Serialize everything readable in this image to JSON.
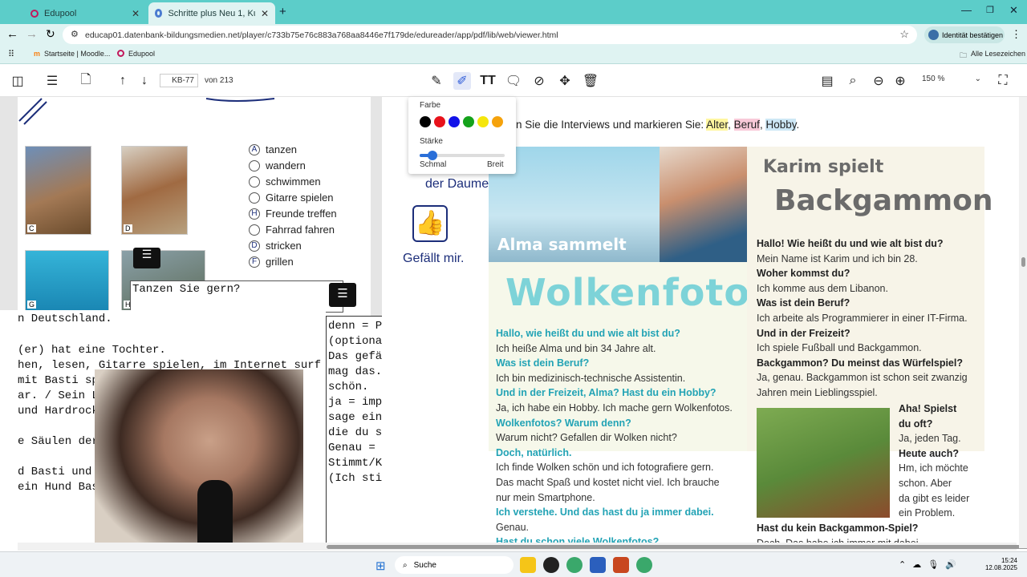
{
  "tabs": [
    {
      "label": "Edupool"
    },
    {
      "label": "Schritte plus Neu 1, Kurs- und A"
    }
  ],
  "address": {
    "url": "educap01.datenbank-bildungsmedien.net/player/c733b75e76c883a768aa8446e7f179de/edureader/app/pdf/lib/web/viewer.html",
    "identity": "Identität bestätigen"
  },
  "bookmarks": {
    "items": [
      "Startseite | Moodle...",
      "Edupool"
    ],
    "all": "Alle Lesezeichen"
  },
  "toolbar": {
    "page_input": "KB-77",
    "page_total": "von 213",
    "zoom": "150 %"
  },
  "color_popup": {
    "farbe": "Farbe",
    "staerke": "Stärke",
    "schmal": "Schmal",
    "breit": "Breit",
    "colors": [
      "#000000",
      "#e8121b",
      "#1212e8",
      "#14a21b",
      "#f5e60c",
      "#f5a20c"
    ],
    "strength": 0.15
  },
  "left_page": {
    "photo_labels": [
      "C",
      "D",
      "G",
      "H"
    ],
    "options": [
      {
        "letter": "A",
        "text": "tanzen"
      },
      {
        "letter": "",
        "text": "wandern"
      },
      {
        "letter": "",
        "text": "schwimmen"
      },
      {
        "letter": "",
        "text": "Gitarre spielen"
      },
      {
        "letter": "H",
        "text": "Freunde treffen"
      },
      {
        "letter": "",
        "text": "Fahrrad fahren"
      },
      {
        "letter": "D",
        "text": "stricken"
      },
      {
        "letter": "F",
        "text": "grillen"
      }
    ],
    "question": "Tanzen Sie gern?",
    "code_lines": [
      "n Deutschland.",
      "(er) hat eine Tochter.",
      "hen, lesen, Gitarre spielen, im Internet surf",
      " mit Basti spazieren gehen, grillen.",
      "ar. / Sein Lieblingsfilm ...ar.",
      "und Hardrock. / Seine ...sik ist Roc",
      "e Säulen der Erde\". / ...gsbuch ist",
      "d Basti und gute Gri...nd wichtig.",
      "ein Hund Basti und g...chen sind"
    ]
  },
  "notepad": [
    "denn = Partikel",
    "(optional)",
    "",
    "Das gefällt mir. = Ich",
    "mag das. Das ist",
    "schön.",
    "",
    "ja = implizit: Ich",
    "sage eine Information,",
    "die du schon kennst.",
    "",
    "Genau =",
    "Stimmt/Korrekt/Richtig",
    "(Ich stimme dir zu)"
  ],
  "mid": {
    "daumen": "der Daumen",
    "gefaellt": "Gefällt mir."
  },
  "instruction": {
    "prefix": "n Sie die Interviews und markieren Sie: ",
    "w1": "Alter",
    "w2": "Beruf",
    "w3": "Hobby",
    "sep": ", ",
    "end": "."
  },
  "alma": {
    "banner": "Alma sammelt",
    "title": "Wolkenfotos",
    "lines": [
      {
        "t": "Hallo, wie heißt du und wie alt bist du?",
        "q": true
      },
      {
        "t": "Ich heiße Alma und bin 34 Jahre alt.",
        "q": false
      },
      {
        "t": "Was ist dein Beruf?",
        "q": true
      },
      {
        "t": "Ich bin medizinisch-technische Assistentin.",
        "q": false
      },
      {
        "t": "Und in der Freizeit, Alma? Hast du ein Hobby?",
        "q": true
      },
      {
        "t": "Ja, ich habe ein Hobby. Ich mache gern Wolkenfotos.",
        "q": false
      },
      {
        "t": "Wolkenfotos? Warum denn?",
        "q": true
      },
      {
        "t": "Warum nicht? Gefallen dir Wolken nicht?",
        "q": false
      },
      {
        "t": "Doch, natürlich.",
        "q": true
      },
      {
        "t": "Ich finde Wolken schön und ich fotografiere gern.",
        "q": false
      },
      {
        "t": "Das macht Spaß und kostet nicht viel. Ich brauche",
        "q": false
      },
      {
        "t": "nur mein Smartphone.",
        "q": false
      },
      {
        "t": "Ich verstehe. Und das hast du ja immer dabei.",
        "q": true
      },
      {
        "t": "Genau.",
        "q": false
      },
      {
        "t": "Hast du schon viele Wolkenfotos?",
        "q": true
      }
    ]
  },
  "karim": {
    "title1": "Karim spielt",
    "title2": "Backgammon",
    "lines": [
      {
        "t": "Hallo! Wie heißt du und wie alt bist du?",
        "b": true
      },
      {
        "t": "Mein Name ist Karim und ich bin 28.",
        "b": false
      },
      {
        "t": "Woher kommst du?",
        "b": true
      },
      {
        "t": "Ich komme aus dem Libanon.",
        "b": false
      },
      {
        "t": "Was ist dein Beruf?",
        "b": true
      },
      {
        "t": "Ich arbeite als Programmierer in einer IT-Firma.",
        "b": false
      },
      {
        "t": "Und in der Freizeit?",
        "b": true
      },
      {
        "t": "Ich spiele Fußball und Backgammon.",
        "b": false
      },
      {
        "t": "Backgammon? Du meinst das Würfelspiel?",
        "b": true
      },
      {
        "t": "Ja, genau. Backgammon ist schon seit zwanzig",
        "b": false
      },
      {
        "t": "Jahren mein Lieblingsspiel.",
        "b": false
      }
    ],
    "side": [
      {
        "t": "Aha! Spielst",
        "b": true
      },
      {
        "t": "du oft?",
        "b": true
      },
      {
        "t": "Ja, jeden Tag.",
        "b": false
      },
      {
        "t": "Heute auch?",
        "b": true
      },
      {
        "t": "Hm, ich möchte",
        "b": false
      },
      {
        "t": "schon. Aber",
        "b": false
      },
      {
        "t": "da gibt es leider",
        "b": false
      },
      {
        "t": "ein Problem.",
        "b": false
      }
    ],
    "bottom": [
      {
        "t": "Hast du kein Backgammon-Spiel?",
        "b": true
      },
      {
        "t": "Doch. Das habe ich immer mit dabei",
        "b": false
      }
    ]
  },
  "taskbar": {
    "search": "Suche",
    "time": "15:24",
    "date": "12.08.2025"
  }
}
